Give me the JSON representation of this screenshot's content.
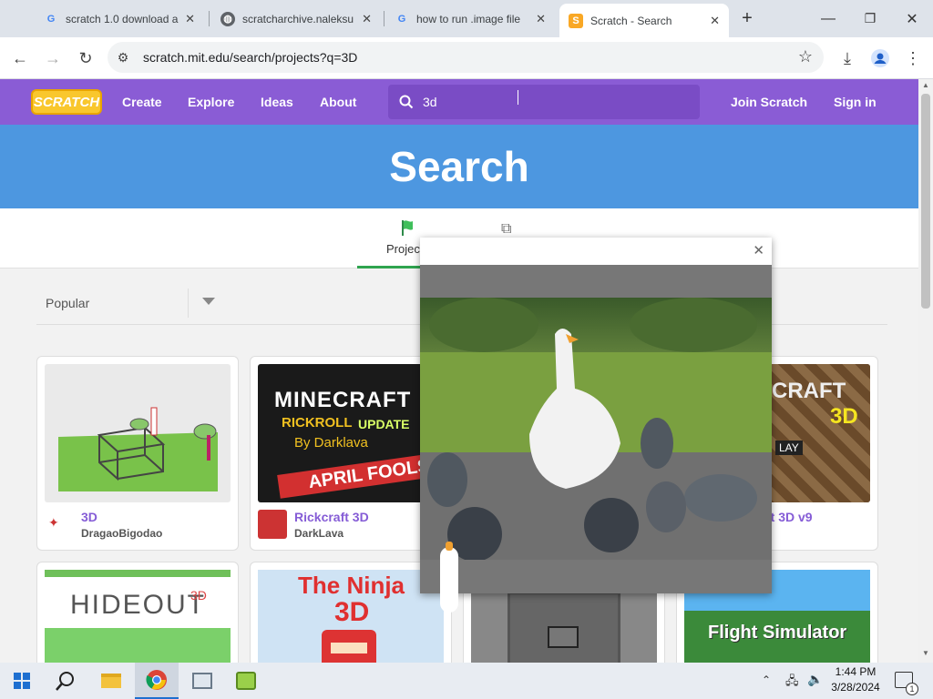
{
  "browser": {
    "tabs": [
      {
        "title": "scratch 1.0 download a",
        "icon": "google-g-icon"
      },
      {
        "title": "scratcharchive.naleksu",
        "icon": "globe-icon"
      },
      {
        "title": "how to run .image file",
        "icon": "google-g-icon"
      },
      {
        "title": "Scratch - Search",
        "icon": "scratch-cat-icon"
      }
    ],
    "url": "scratch.mit.edu/search/projects?q=3D"
  },
  "nav": {
    "logo": "SCRATCH",
    "links": [
      "Create",
      "Explore",
      "Ideas",
      "About"
    ],
    "search_value": "3d",
    "join": "Join Scratch",
    "signin": "Sign in"
  },
  "banner": {
    "title": "Search"
  },
  "search_tabs": {
    "projects": "Projec"
  },
  "filter": {
    "sort": "Popular"
  },
  "projects": [
    {
      "title": "3D",
      "author": "DragaoBigodao"
    },
    {
      "title": "Rickcraft 3D",
      "author": "DarkLava"
    },
    {
      "title": "ft 3D v9",
      "author": ""
    }
  ],
  "thumb_text": {
    "minecraft": "MINECRAFT",
    "rickroll": "RICKROLL",
    "update": "UPDATE",
    "bydark": "By Darklava",
    "aprilfools": "APRIL FOOLS",
    "craft": "CRAFT",
    "threed": "3D",
    "lay": "LAY",
    "hideout": "HIDEOUT",
    "hideout_sup": "3D",
    "ninja": "The Ninja",
    "ninja3d": "3D",
    "flight": "Flight Simulator"
  },
  "taskbar": {
    "time": "1:44 PM",
    "date": "3/28/2024",
    "notifications": "1"
  },
  "colors": {
    "scratch_purple": "#8a5cd5",
    "banner_blue": "#4d97e0",
    "link_purple": "#855cd6"
  }
}
